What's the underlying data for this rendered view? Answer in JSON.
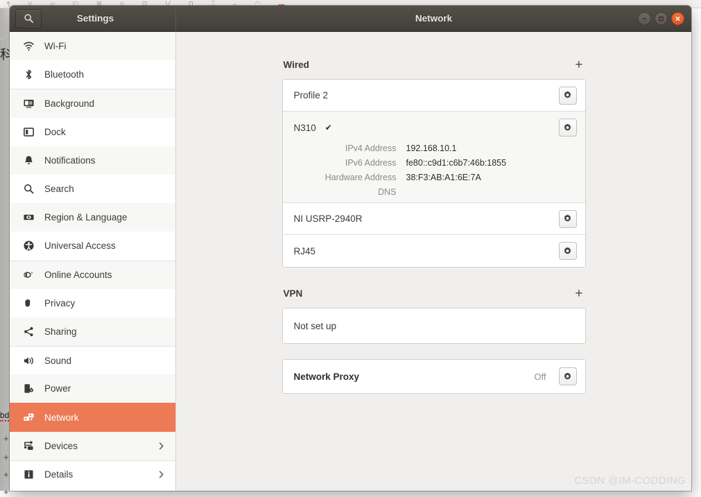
{
  "backdrop": {
    "toolbar_items": [
      "¶",
      "\\/",
      "▱",
      "◱",
      "⊞",
      "()",
      "⊡",
      "⋁",
      "⊓",
      "⌶",
      "⌐",
      "◠",
      "≡"
    ],
    "toolbar_accent": "▬",
    "cjk_fragment": "科",
    "word_fragment": "bd",
    "plus_marks": [
      "+",
      "+",
      "+",
      "+"
    ]
  },
  "titlebar": {
    "search_icon": "search-icon",
    "settings_title": "Settings",
    "page_title": "Network",
    "controls": {
      "minimize": "minimize-button",
      "maximize": "maximize-button",
      "close": "close-button"
    },
    "close_color": "#e2552a"
  },
  "sidebar": {
    "active_color": "#ec7a54",
    "items": [
      {
        "label": "Wi-Fi",
        "icon": "wifi-icon",
        "active": false,
        "chevron": false
      },
      {
        "label": "Bluetooth",
        "icon": "bluetooth-icon",
        "active": false,
        "chevron": false
      },
      {
        "label": "Background",
        "icon": "background-icon",
        "active": false,
        "chevron": false
      },
      {
        "label": "Dock",
        "icon": "dock-icon",
        "active": false,
        "chevron": false
      },
      {
        "label": "Notifications",
        "icon": "bell-icon",
        "active": false,
        "chevron": false
      },
      {
        "label": "Search",
        "icon": "search-icon",
        "active": false,
        "chevron": false
      },
      {
        "label": "Region & Language",
        "icon": "region-language-icon",
        "active": false,
        "chevron": false
      },
      {
        "label": "Universal Access",
        "icon": "universal-access-icon",
        "active": false,
        "chevron": false
      },
      {
        "label": "Online Accounts",
        "icon": "online-accounts-icon",
        "active": false,
        "chevron": false
      },
      {
        "label": "Privacy",
        "icon": "privacy-hand-icon",
        "active": false,
        "chevron": false
      },
      {
        "label": "Sharing",
        "icon": "sharing-icon",
        "active": false,
        "chevron": false
      },
      {
        "label": "Sound",
        "icon": "sound-icon",
        "active": false,
        "chevron": false
      },
      {
        "label": "Power",
        "icon": "power-icon",
        "active": false,
        "chevron": false
      },
      {
        "label": "Network",
        "icon": "network-icon",
        "active": true,
        "chevron": false
      },
      {
        "label": "Devices",
        "icon": "devices-icon",
        "active": false,
        "chevron": true
      },
      {
        "label": "Details",
        "icon": "details-info-icon",
        "active": false,
        "chevron": true
      }
    ]
  },
  "main": {
    "wired": {
      "section_title": "Wired",
      "add_label": "+",
      "connections": [
        {
          "name": "Profile 2",
          "connected": false,
          "check": "",
          "settings_icon": "gear-icon"
        },
        {
          "name": "N310",
          "connected": true,
          "check": "✔",
          "settings_icon": "gear-icon",
          "details": [
            {
              "label": "IPv4 Address",
              "value": "192.168.10.1"
            },
            {
              "label": "IPv6 Address",
              "value": "fe80::c9d1:c6b7:46b:1855"
            },
            {
              "label": "Hardware Address",
              "value": "38:F3:AB:A1:6E:7A"
            },
            {
              "label": "DNS",
              "value": ""
            }
          ]
        },
        {
          "name": "NI USRP-2940R",
          "connected": false,
          "check": "",
          "settings_icon": "gear-icon"
        },
        {
          "name": "RJ45",
          "connected": false,
          "check": "",
          "settings_icon": "gear-icon"
        }
      ]
    },
    "vpn": {
      "section_title": "VPN",
      "add_label": "+",
      "status": "Not set up"
    },
    "proxy": {
      "title": "Network Proxy",
      "state": "Off",
      "settings_icon": "gear-icon"
    }
  },
  "watermark": "CSDN @IM-CODDING"
}
